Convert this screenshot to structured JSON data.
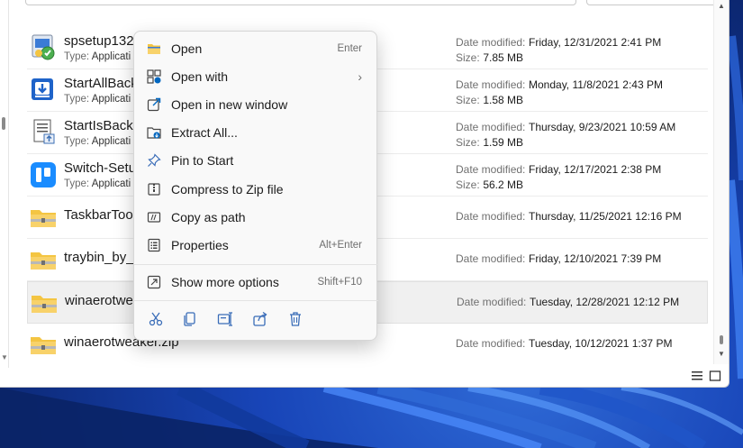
{
  "files": [
    {
      "name": "spsetup132.",
      "type_label": "Type:",
      "type_value": "Applicati",
      "meta1_label": "Date modified:",
      "meta1_value": "Friday, 12/31/2021 2:41 PM",
      "meta2_label": "Size:",
      "meta2_value": "7.85 MB",
      "icon": "installer-icon"
    },
    {
      "name": "StartAllBack",
      "type_label": "Type:",
      "type_value": "Applicati",
      "meta1_label": "Date modified:",
      "meta1_value": "Monday, 11/8/2021 2:43 PM",
      "meta2_label": "Size:",
      "meta2_value": "1.58 MB",
      "icon": "startallback-icon"
    },
    {
      "name": "StartIsBackT",
      "type_label": "Type:",
      "type_value": "Applicati",
      "meta1_label": "Date modified:",
      "meta1_value": "Thursday, 9/23/2021 10:59 AM",
      "meta2_label": "Size:",
      "meta2_value": "1.59 MB",
      "icon": "setup-document-icon"
    },
    {
      "name": "Switch-Setu",
      "type_label": "Type:",
      "type_value": "Applicati",
      "meta1_label": "Date modified:",
      "meta1_value": "Friday, 12/17/2021 2:38 PM",
      "meta2_label": "Size:",
      "meta2_value": "56.2 MB",
      "icon": "switch-app-icon"
    },
    {
      "name": "TaskbarTool",
      "meta1_label": "Date modified:",
      "meta1_value": "Thursday, 11/25/2021 12:16 PM",
      "icon": "zip-folder-icon"
    },
    {
      "name": "traybin_by_l",
      "meta1_label": "Date modified:",
      "meta1_value": "Friday, 12/10/2021 7:39 PM",
      "icon": "zip-folder-icon"
    },
    {
      "name": "winaerotwe",
      "meta1_label": "Date modified:",
      "meta1_value": "Tuesday, 12/28/2021 12:12 PM",
      "icon": "zip-folder-icon",
      "selected": true
    },
    {
      "name": "winaerotweaker.zip",
      "meta1_label": "Date modified:",
      "meta1_value": "Tuesday, 10/12/2021 1:37 PM",
      "icon": "zip-folder-icon"
    }
  ],
  "context_menu": {
    "items": [
      {
        "label": "Open",
        "accel": "Enter",
        "icon": "open-folder-icon"
      },
      {
        "label": "Open with",
        "chevron": "›",
        "icon": "open-with-icon"
      },
      {
        "label": "Open in new window",
        "icon": "new-window-icon"
      },
      {
        "label": "Extract All...",
        "icon": "extract-icon"
      },
      {
        "label": "Pin to Start",
        "icon": "pin-icon"
      },
      {
        "label": "Compress to Zip file",
        "icon": "zip-compress-icon"
      },
      {
        "label": "Copy as path",
        "icon": "copy-path-icon"
      },
      {
        "label": "Properties",
        "accel": "Alt+Enter",
        "icon": "properties-icon"
      },
      {
        "label": "Show more options",
        "accel": "Shift+F10",
        "icon": "more-options-icon"
      }
    ],
    "quick_actions": [
      "cut-icon",
      "copy-icon",
      "rename-icon",
      "share-icon",
      "delete-icon"
    ]
  },
  "colors": {
    "accent": "#0067c0",
    "folder_yellow": "#f4c542",
    "wallpaper": "#1845b8"
  }
}
